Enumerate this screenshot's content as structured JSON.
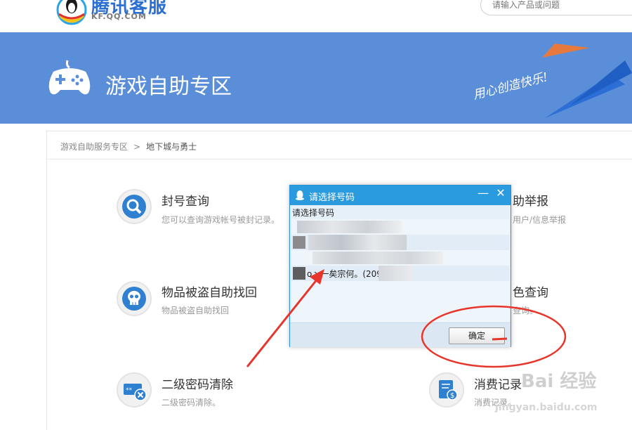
{
  "header": {
    "logo_text": "腾讯客服",
    "logo_sub": "KF.QQ.COM",
    "search_placeholder": "请输入产品或问题"
  },
  "banner": {
    "title": "游戏自助专区",
    "slogan": "用心创造快乐!"
  },
  "breadcrumb": {
    "root": "游戏自助服务专区",
    "sep": ">",
    "current": "地下城与勇士"
  },
  "services": [
    {
      "title": "封号查询",
      "desc": "您可以查询游戏帐号被封记录。",
      "icon": "search-icon"
    },
    {
      "title": "物品被盗自助找回",
      "desc": "物品被盗自助找回",
      "icon": "skull-icon"
    },
    {
      "title": "二级密码清除",
      "desc": "二级密码清除。",
      "icon": "password-clear-icon"
    },
    {
      "title": "助举报",
      "desc": "用户/信息举报",
      "icon": "report-icon"
    },
    {
      "title": "色查询",
      "desc": "查询。",
      "icon": "role-query-icon"
    },
    {
      "title": "消费记录",
      "desc": "消费记录。",
      "icon": "receipt-icon"
    }
  ],
  "dialog": {
    "title": "请选择号码",
    "label": "请选择号码",
    "accounts": [
      {
        "text": ""
      },
      {
        "text": ""
      },
      {
        "text": ""
      },
      {
        "text": "o丶一矣宗何。(209"
      }
    ],
    "ok_label": "确定",
    "min_glyph": "—",
    "close_glyph": "✕"
  },
  "watermark": {
    "text": "Bai 经验",
    "url": "jingyan.baidu.com"
  },
  "colors": {
    "banner": "#5b8ed8",
    "dialog_titlebar": "#2a9bde",
    "annotation": "#e8352b",
    "icon_blue": "#2f80d0"
  }
}
